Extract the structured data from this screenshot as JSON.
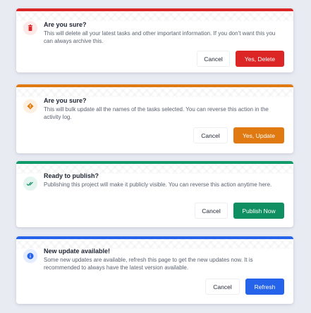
{
  "dialogs": [
    {
      "variant": "danger",
      "accent": "#dc2626",
      "icon": "trash-icon",
      "title": "Are you sure?",
      "message": "This will delete all your latest tasks and other important information. If you don't want this you can always archive this.",
      "cancel_label": "Cancel",
      "confirm_label": "Yes, Delete"
    },
    {
      "variant": "warning",
      "accent": "#e07a10",
      "icon": "warning-diamond-icon",
      "title": "Are you sure?",
      "message": "This will bulk update all the names of the tasks selected. You can reverse this action in the activity log.",
      "cancel_label": "Cancel",
      "confirm_label": "Yes, Update"
    },
    {
      "variant": "success",
      "accent": "#0f8f62",
      "icon": "double-check-icon",
      "title": "Ready to publish?",
      "message": "Publishing this project will make it publicly visible. You can reverse this action anytime here.",
      "cancel_label": "Cancel",
      "confirm_label": "Publish Now"
    },
    {
      "variant": "info",
      "accent": "#2563eb",
      "icon": "info-icon",
      "title": "New update available!",
      "message": "Some new updates are available, refresh this page to get the new updates now. It is recommended to always have the latest version available.",
      "cancel_label": "Cancel",
      "confirm_label": "Refresh"
    }
  ]
}
